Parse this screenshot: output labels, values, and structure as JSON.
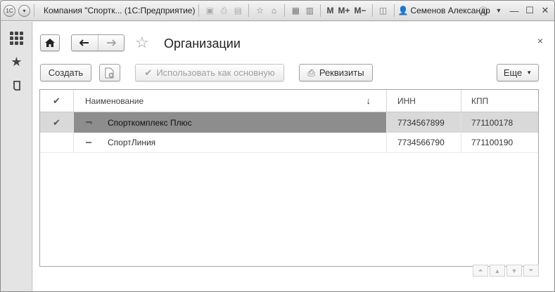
{
  "titlebar": {
    "app_title": "Компания \"Спортк...  (1С:Предприятие)",
    "m_labels": [
      "M",
      "M+",
      "M−"
    ],
    "user": "Семенов Александр"
  },
  "leftbar": {
    "icons": [
      "apps-grid-icon",
      "favorites-star-icon",
      "history-icon"
    ]
  },
  "page": {
    "title": "Организации",
    "close_symbol": "×"
  },
  "commands": {
    "create": "Создать",
    "use_default": "Использовать как основную",
    "requisites": "Реквизиты",
    "more": "Еще"
  },
  "table": {
    "columns": [
      "Наименование",
      "ИНН",
      "КПП"
    ],
    "rows": [
      {
        "name": "Спорткомплекс Плюс",
        "inn": "7734567899",
        "kpp": "771100178",
        "selected": true,
        "default": true
      },
      {
        "name": "СпортЛиния",
        "inn": "7734566790",
        "kpp": "771100190",
        "selected": false,
        "default": false
      }
    ]
  }
}
